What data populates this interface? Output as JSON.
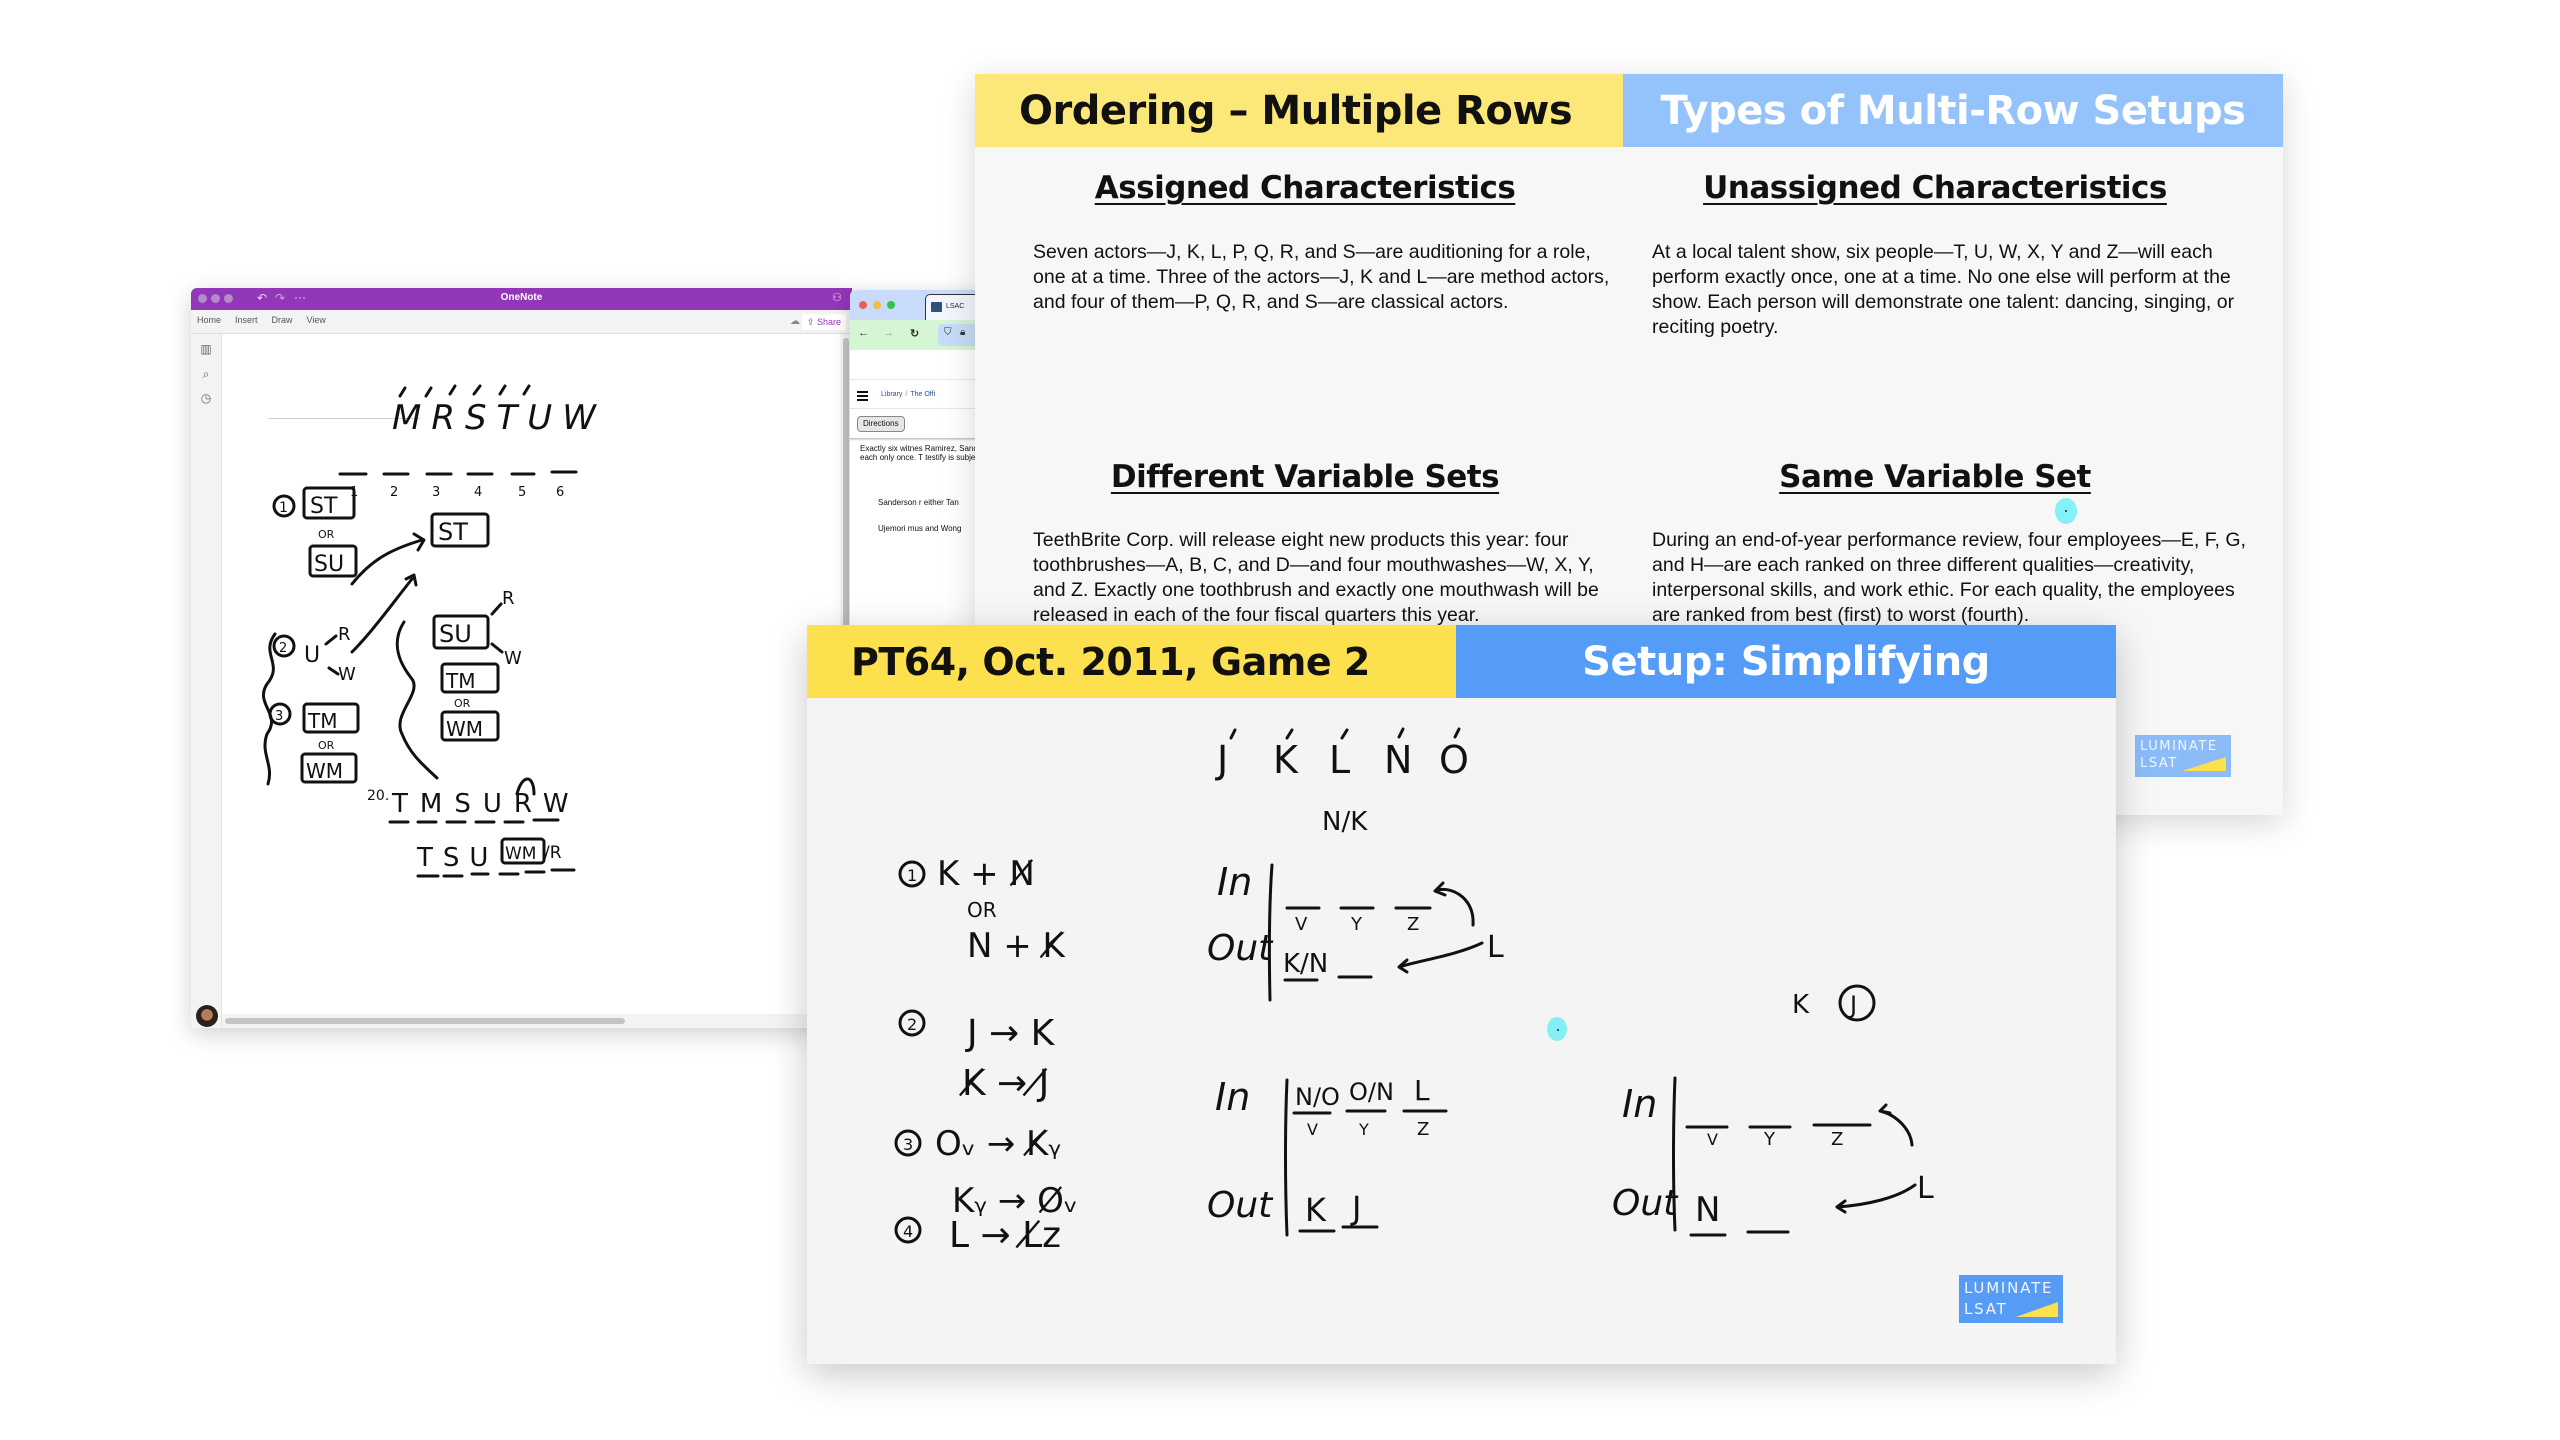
{
  "onenote": {
    "title": "OneNote",
    "menu": [
      "Home",
      "Insert",
      "Draw",
      "View"
    ],
    "share_label": "Share",
    "ink": {
      "top_letters": "MRSTUW",
      "slot_numbers": [
        "1",
        "2",
        "3",
        "4",
        "5",
        "6"
      ],
      "rule_1": {
        "num": "1",
        "a": "ST",
        "or": "OR",
        "b": "SU"
      },
      "rule_2": {
        "num": "2",
        "main": "U",
        "branch_up": "R",
        "branch_down": "W"
      },
      "rule_3": {
        "num": "3",
        "a": "TM",
        "or": "OR",
        "b": "WM"
      },
      "combined_a": "ST",
      "combined_b": "SU",
      "combined_b_up": "R",
      "combined_b_down": "W",
      "combined_c": "TM",
      "combined_or": "OR",
      "combined_d": "WM",
      "q20_label": "20.",
      "q20_row1": [
        "T",
        "M",
        "S",
        "U",
        "R",
        "W"
      ],
      "q20_row2": [
        "T",
        "S",
        "U"
      ],
      "q20_row2_block": "WM",
      "q20_row2_alt": "/R"
    }
  },
  "browser": {
    "tab_label": "LSAC",
    "nav": {
      "back": "←",
      "forward": "→",
      "reload": "C"
    },
    "breadcrumb": [
      "Library",
      "The Offi"
    ],
    "directions_label": "Directions",
    "passage": "Exactly six witnes Ramirez, Sander Wong. The witnes each only once. T testify is subject t",
    "rules": [
      "Sanderson r either Tan",
      "Ujemori mus and Wong"
    ]
  },
  "slide_back": {
    "header_left": "Ordering – Multiple Rows",
    "header_right": "Types of Multi-Row Setups",
    "sections": [
      {
        "title": "Assigned Characteristics",
        "body": "Seven actors—J, K, L, P, Q, R, and S—are auditioning for a role, one at a time. Three of the actors—J, K and L—are method actors, and four of them—P, Q, R, and S—are classical actors."
      },
      {
        "title": "Unassigned Characteristics",
        "body": "At a local talent show, six people—T, U, W, X, Y and Z—will each perform exactly once, one at a time. No one else will perform at the show. Each person will demonstrate one talent: dancing, singing, or reciting poetry."
      },
      {
        "title": "Different Variable Sets",
        "body": "TeethBrite Corp. will release eight new products this year: four toothbrushes—A, B, C, and D—and four mouthwashes—W, X, Y, and Z. Exactly one toothbrush and exactly one mouthwash will be released in each of the four fiscal quarters this year."
      },
      {
        "title": "Same Variable Set",
        "body": "During an end-of-year performance review, four employees—E, F, G, and H—are each ranked on three different qualities—creativity, interpersonal skills, and work ethic. For each quality, the employees are ranked from best (first) to worst (fourth)."
      }
    ],
    "logo": {
      "line1": "LUMINATE",
      "line2": "LSAT"
    }
  },
  "slide_front": {
    "header_left": "PT64, Oct. 2011, Game 2",
    "header_right": "Setup: Simplifying",
    "ink": {
      "variables": [
        "J",
        "K",
        "L",
        "N",
        "O"
      ],
      "rules": {
        "r1": {
          "num": "1",
          "line1": "K + N̸",
          "or": "OR",
          "line2": "N + K̸"
        },
        "r2": {
          "num": "2",
          "line1": "J → K",
          "line2": "K̸ → J̸"
        },
        "r3": {
          "num": "3",
          "line1": "Oᵥ → K̸ᵧ",
          "line2": "Kᵧ → O̸ᵥ"
        },
        "r4": {
          "num": "4",
          "line1": "L → L̸z"
        }
      },
      "diagram_1": {
        "above": "N/K",
        "in_label": "In",
        "out_label": "Out",
        "in_slots": [
          "V",
          "Y",
          "Z"
        ],
        "out_slots": [
          "K/N",
          ""
        ],
        "floater": "L"
      },
      "diagram_2": {
        "in_label": "In",
        "out_label": "Out",
        "in_values": [
          "N/O",
          "O/N",
          "L"
        ],
        "in_slots": [
          "V",
          "Y",
          "Z"
        ],
        "out_values": [
          "K",
          "J"
        ]
      },
      "diagram_3": {
        "above_k": "K",
        "above_j_circled": "J",
        "in_label": "In",
        "out_label": "Out",
        "in_slots": [
          "V",
          "Y",
          "Z"
        ],
        "out_values": [
          "N",
          ""
        ],
        "floater": "L"
      }
    },
    "logo": {
      "line1": "LUMINATE",
      "line2": "LSAT"
    }
  },
  "colors": {
    "onenote_purple": "#9237b8",
    "back_header_yellow": "#fce879",
    "back_header_blue": "#94c3fb",
    "front_header_yellow": "#fde04d",
    "front_header_blue": "#559bf8",
    "cursor_highlight": "#6ff0f5"
  }
}
